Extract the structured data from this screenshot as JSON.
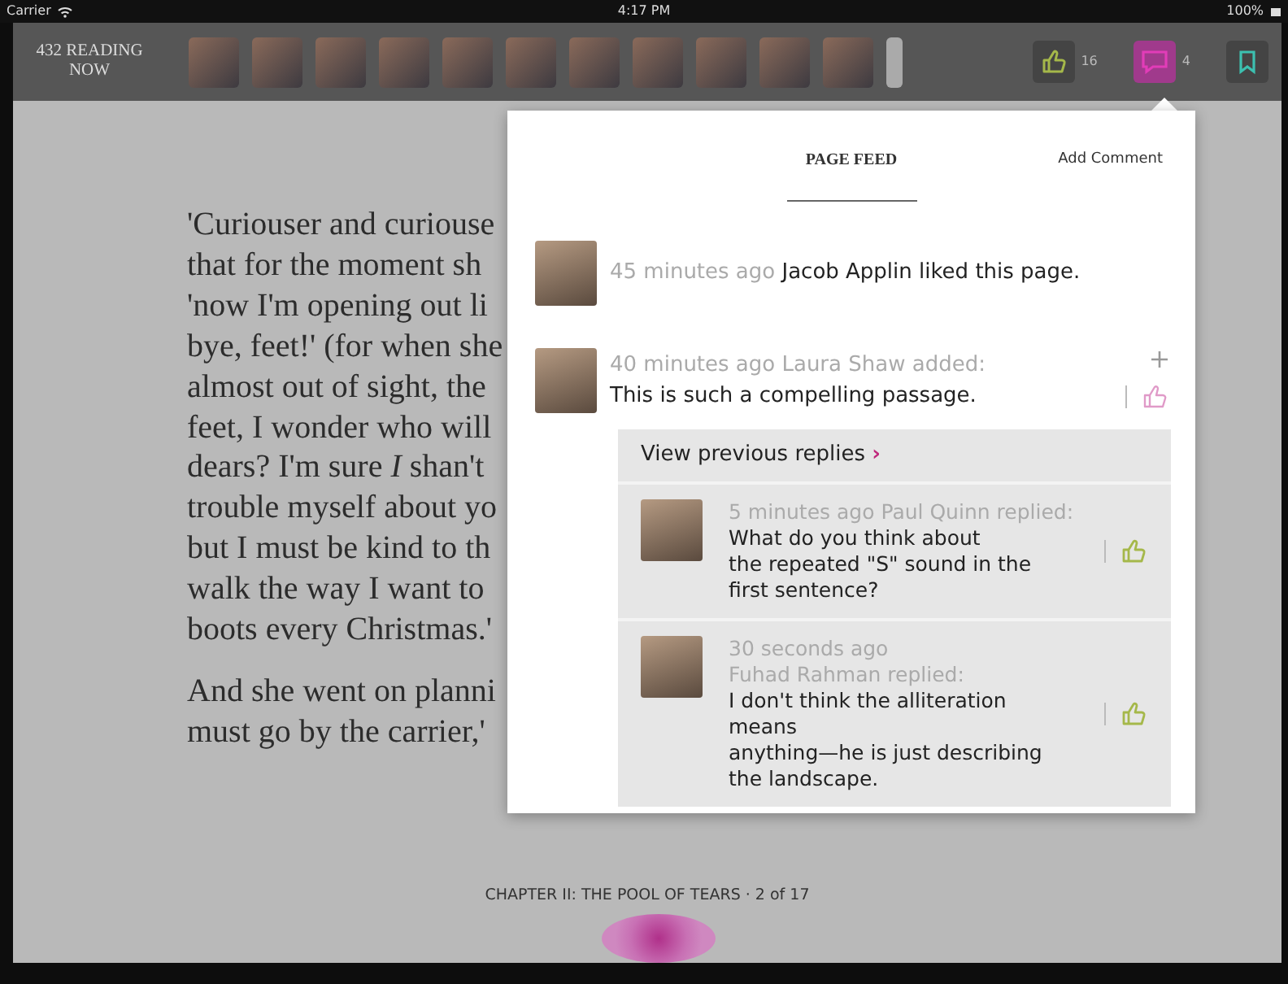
{
  "status_bar": {
    "carrier": "Carrier",
    "time": "4:17 PM",
    "battery": "100%"
  },
  "toolbar": {
    "reading_now": "432 READING NOW",
    "readers": [
      {
        "kind": "photo"
      },
      {
        "kind": "photo"
      },
      {
        "kind": "photo"
      },
      {
        "kind": "photo"
      },
      {
        "kind": "photo"
      },
      {
        "kind": "photo"
      },
      {
        "kind": "photo"
      },
      {
        "kind": "photo"
      },
      {
        "kind": "photo"
      },
      {
        "kind": "photo"
      },
      {
        "kind": "photo"
      },
      {
        "kind": "partial"
      }
    ],
    "buttons": [
      {
        "kind": "like",
        "count": "16",
        "selected": false
      },
      {
        "kind": "comment",
        "count": "4",
        "selected": true
      },
      {
        "kind": "bookmark",
        "selected": false
      }
    ]
  },
  "book": {
    "paragraphs": [
      [
        "'Curiouser and curiouse",
        "that for the moment sh",
        "'now I'm opening out li",
        "bye, feet!' (for when she",
        "almost out of sight, the",
        "feet, I wonder who will",
        "dears? I'm sure *I* shan't",
        "trouble myself about yo",
        "but I must be kind to th",
        "walk the way I want to",
        "boots every Christmas.'"
      ],
      [
        "And she went on planni",
        "must go by the carrier,'"
      ]
    ],
    "footer": "CHAPTER II: THE POOL OF TEARS · 2 of 17"
  },
  "page_feed": {
    "title": "PAGE FEED",
    "add_comment": "Add Comment",
    "items": [
      {
        "kind": "like",
        "time": "45 minutes ago",
        "text": "Jacob Applin liked this page."
      },
      {
        "kind": "comment",
        "meta": "40 minutes ago Laura Shaw added:",
        "text": "This is such a compelling passage.",
        "replies": {
          "view_previous": "View previous replies",
          "chevron": "›",
          "items": [
            {
              "meta_lines": [
                "5 minutes ago Paul Quinn replied:"
              ],
              "body_lines": [
                "What do you think about",
                "the repeated \"S\" sound in the",
                "first sentence?"
              ]
            },
            {
              "meta_lines": [
                "30 seconds ago",
                "Fuhad Rahman replied:"
              ],
              "body_lines": [
                "I don't think the alliteration means",
                "anything—he is just describing",
                "the landscape."
              ]
            }
          ]
        }
      }
    ]
  }
}
